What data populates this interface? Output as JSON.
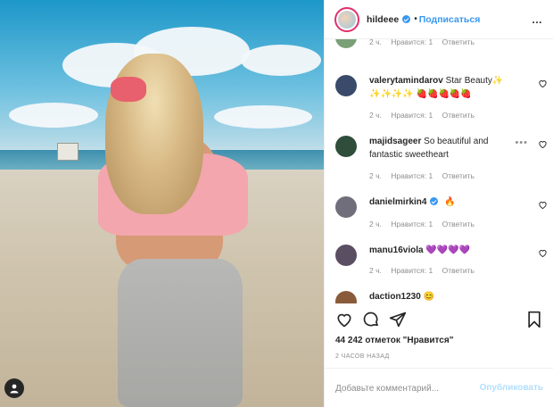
{
  "header": {
    "username": "hildeee",
    "separator": "•",
    "follow_label": "Подписаться",
    "more_icon": "…"
  },
  "comments": [
    {
      "username": "",
      "text": "",
      "time": "2 ч.",
      "likes": "Нравится: 1",
      "reply": "Ответить",
      "avatar_color": "#7aa078"
    },
    {
      "username": "valerytamindarov",
      "text": "Star Beauty✨ ✨✨✨✨ 🍓🍓🍓🍓🍓",
      "time": "2 ч.",
      "likes": "Нравится: 1",
      "reply": "Ответить",
      "avatar_color": "#3a4a6b"
    },
    {
      "username": "majidsageer",
      "text": "So beautiful and fantastic sweetheart",
      "time": "2 ч.",
      "likes": "Нравится: 1",
      "reply": "Ответить",
      "avatar_color": "#2f4d3b"
    },
    {
      "username": "danielmirkin4",
      "text": "🔥",
      "time": "2 ч.",
      "likes": "Нравится: 1",
      "reply": "Ответить",
      "avatar_color": "#6f6e7a",
      "verified": true
    },
    {
      "username": "manu16viola",
      "text": "💜💜💜💜",
      "time": "2 ч.",
      "likes": "Нравится: 1",
      "reply": "Ответить",
      "avatar_color": "#5a4e62"
    },
    {
      "username": "daction1230",
      "text": "😊",
      "time": "",
      "likes": "",
      "reply": "",
      "avatar_color": "#8a5b3a"
    }
  ],
  "likes_text": "44 242 отметок \"Нравится\"",
  "posted_ago": "2 ЧАСОВ НАЗАД",
  "comment_input": {
    "placeholder": "Добавьте комментарий...",
    "post_label": "Опубликовать"
  },
  "colors": {
    "accent": "#3897f0",
    "muted": "#8e8e8e",
    "post_disabled": "#b2dffc"
  }
}
